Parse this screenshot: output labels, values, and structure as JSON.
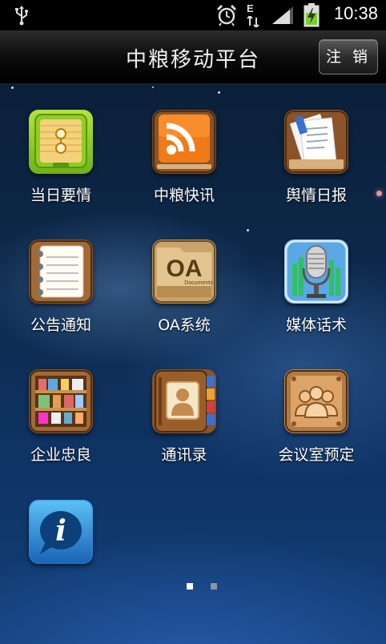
{
  "status_bar": {
    "time": "10:38",
    "icons": [
      "usb-icon",
      "alarm-icon",
      "network-e-icon",
      "signal-icon",
      "battery-charging-icon"
    ],
    "network_type": "E"
  },
  "title_bar": {
    "title": "中粮移动平台",
    "logout_label": "注 销"
  },
  "apps": [
    {
      "label": "当日要情",
      "icon": "envelope-document-icon"
    },
    {
      "label": "中粮快讯",
      "icon": "rss-feed-icon"
    },
    {
      "label": "舆情日报",
      "icon": "papers-tray-icon"
    },
    {
      "label": "公告通知",
      "icon": "notepad-icon"
    },
    {
      "label": "OA系统",
      "icon": "oa-folder-icon",
      "badge_text": "OA",
      "badge_sub": "Documents"
    },
    {
      "label": "媒体话术",
      "icon": "microphone-icon"
    },
    {
      "label": "企业忠良",
      "icon": "bookshelf-icon"
    },
    {
      "label": "通讯录",
      "icon": "address-book-icon"
    },
    {
      "label": "会议室预定",
      "icon": "meeting-room-icon"
    },
    {
      "label": "",
      "icon": "info-bubble-icon",
      "badge_text": "i"
    }
  ],
  "page_indicator": {
    "pages": 2,
    "current": 1
  }
}
